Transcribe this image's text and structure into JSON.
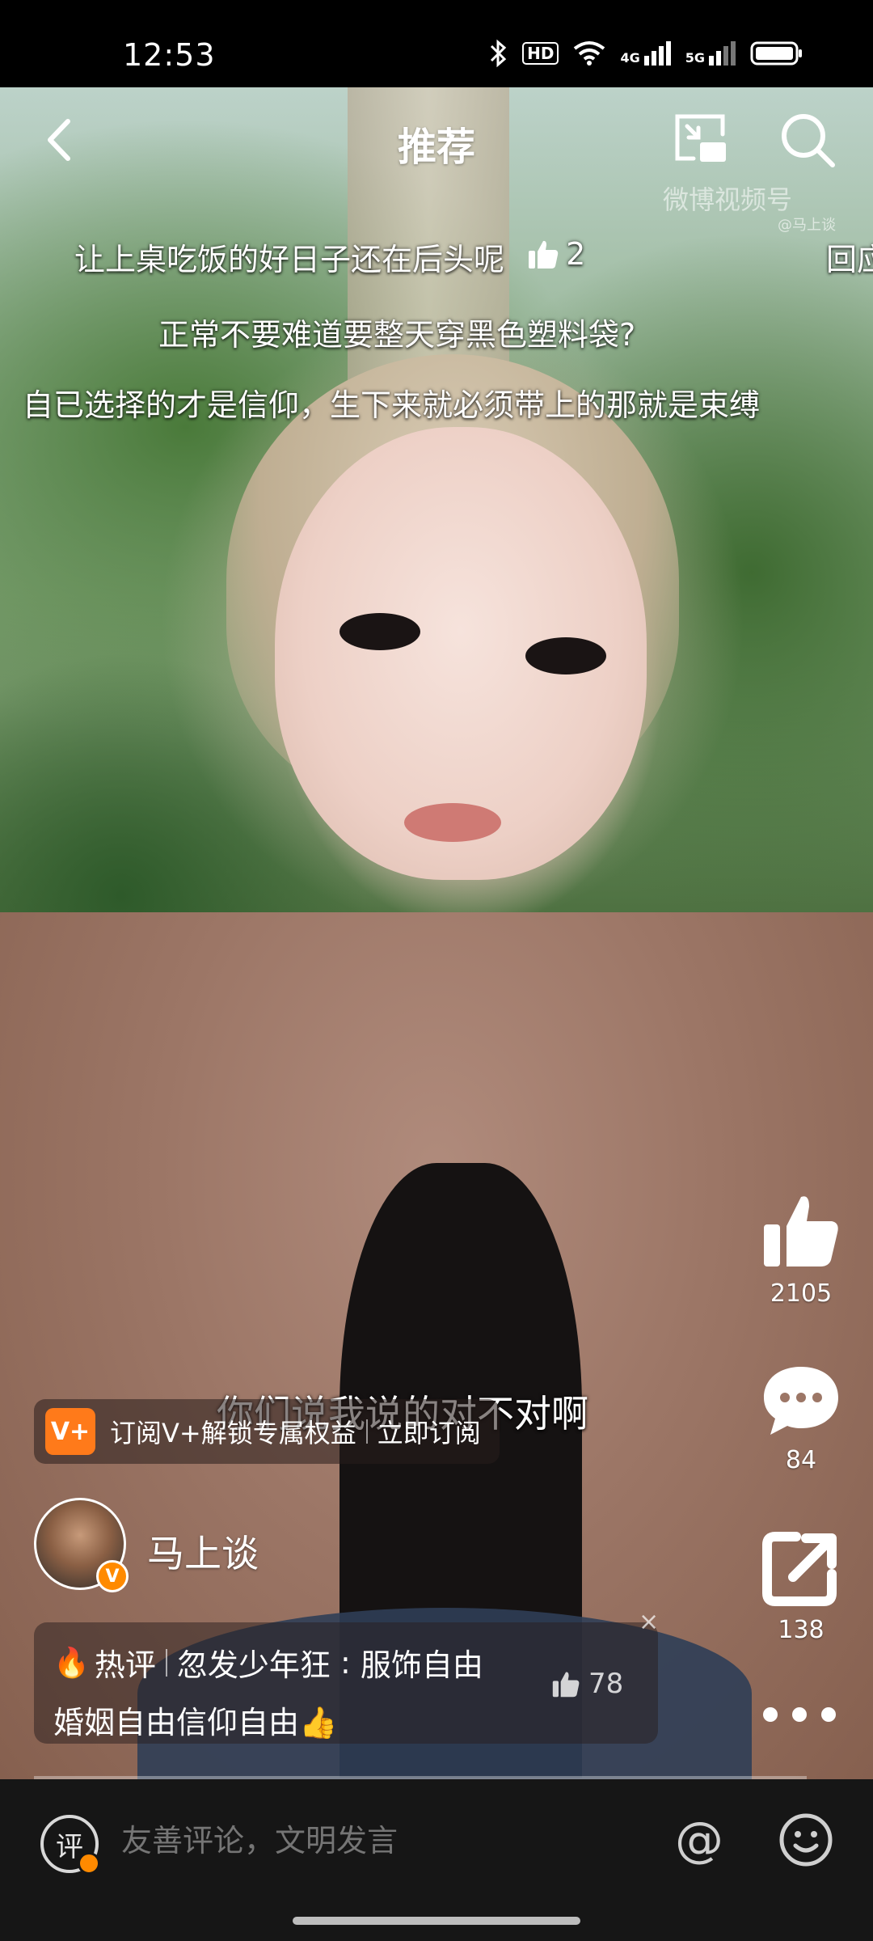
{
  "status_bar": {
    "time": "12:53",
    "icons": [
      "bluetooth-icon",
      "hd-icon",
      "wifi-icon",
      "signal-4g-icon",
      "signal-5g-icon",
      "battery-icon"
    ],
    "hd_label": "HD",
    "net1": "4G",
    "net2": "5G"
  },
  "nav": {
    "title": "推荐"
  },
  "watermark": {
    "brand": "微博视频号",
    "handle": "@马上谈"
  },
  "danmaku": [
    {
      "text": "让上桌吃饭的好日子还在后头呢",
      "likes": "2"
    },
    {
      "text": "正常不要难道要整天穿黑色塑料袋?"
    },
    {
      "text": "自已选择的才是信仰，生下来就必须带上的那就是束缚"
    },
    {
      "text": "回应"
    }
  ],
  "subtitle": "你们说我说的对不对啊",
  "actions": {
    "likes": "2105",
    "comments": "84",
    "shares": "138"
  },
  "vip_banner": {
    "badge": "V+",
    "text": "订阅V+解锁专属权益",
    "cta": "立即订阅"
  },
  "author": {
    "name": "马上谈",
    "verified_badge": "V"
  },
  "hot_comment": {
    "tag": "热评",
    "user": "忽发少年狂",
    "line1_text": "服饰自由",
    "line2_text": "婚姻自由信仰自由👍",
    "likes": "78",
    "close": "×"
  },
  "progress": 0.0,
  "bottom_bar": {
    "comment_icon_label": "评",
    "placeholder": "友善评论，文明发言",
    "at_label": "@"
  },
  "colors": {
    "accent": "#ff8a00",
    "vip_badge": "#ff7a1a",
    "fire": "#ff5a1f",
    "bottom_bar": "#161616"
  }
}
